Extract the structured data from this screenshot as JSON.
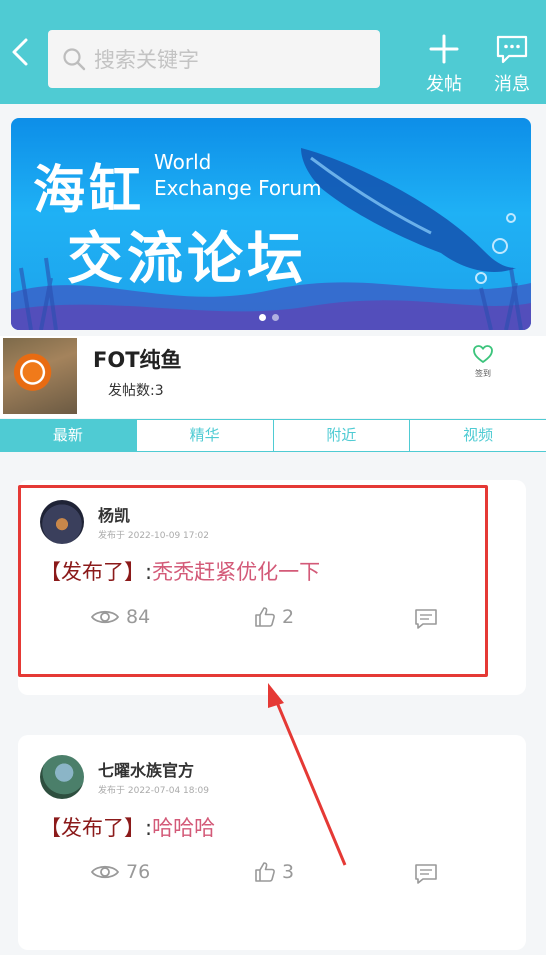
{
  "header": {
    "search_placeholder": "搜索关键字",
    "post_label": "发帖",
    "messages_label": "消息"
  },
  "banner": {
    "title_line1": "海缸",
    "title_line2": "交流论坛",
    "english_line1": "World",
    "english_line2": "Exchange Forum"
  },
  "forum": {
    "name": "FOT纯鱼",
    "post_count_label": "发帖数:3",
    "follow_label": "签到"
  },
  "tabs": [
    "最新",
    "精华",
    "附近",
    "视频"
  ],
  "posts": [
    {
      "author": "杨凯",
      "time": "发布于 2022-10-09 17:02",
      "prefix": "【发布了】",
      "colon": ":",
      "content": "秃秃赶紧优化一下",
      "views": "84",
      "likes": "2"
    },
    {
      "author": "七曜水族官方",
      "time": "发布于 2022-07-04 18:09",
      "prefix": "【发布了】",
      "colon": ":",
      "content": "哈哈哈",
      "views": "76",
      "likes": "3"
    }
  ],
  "colors": {
    "accent": "#4fcbd3",
    "highlight_border": "#e53935",
    "post_prefix": "#8b1a1a",
    "post_content": "#d35a78"
  }
}
